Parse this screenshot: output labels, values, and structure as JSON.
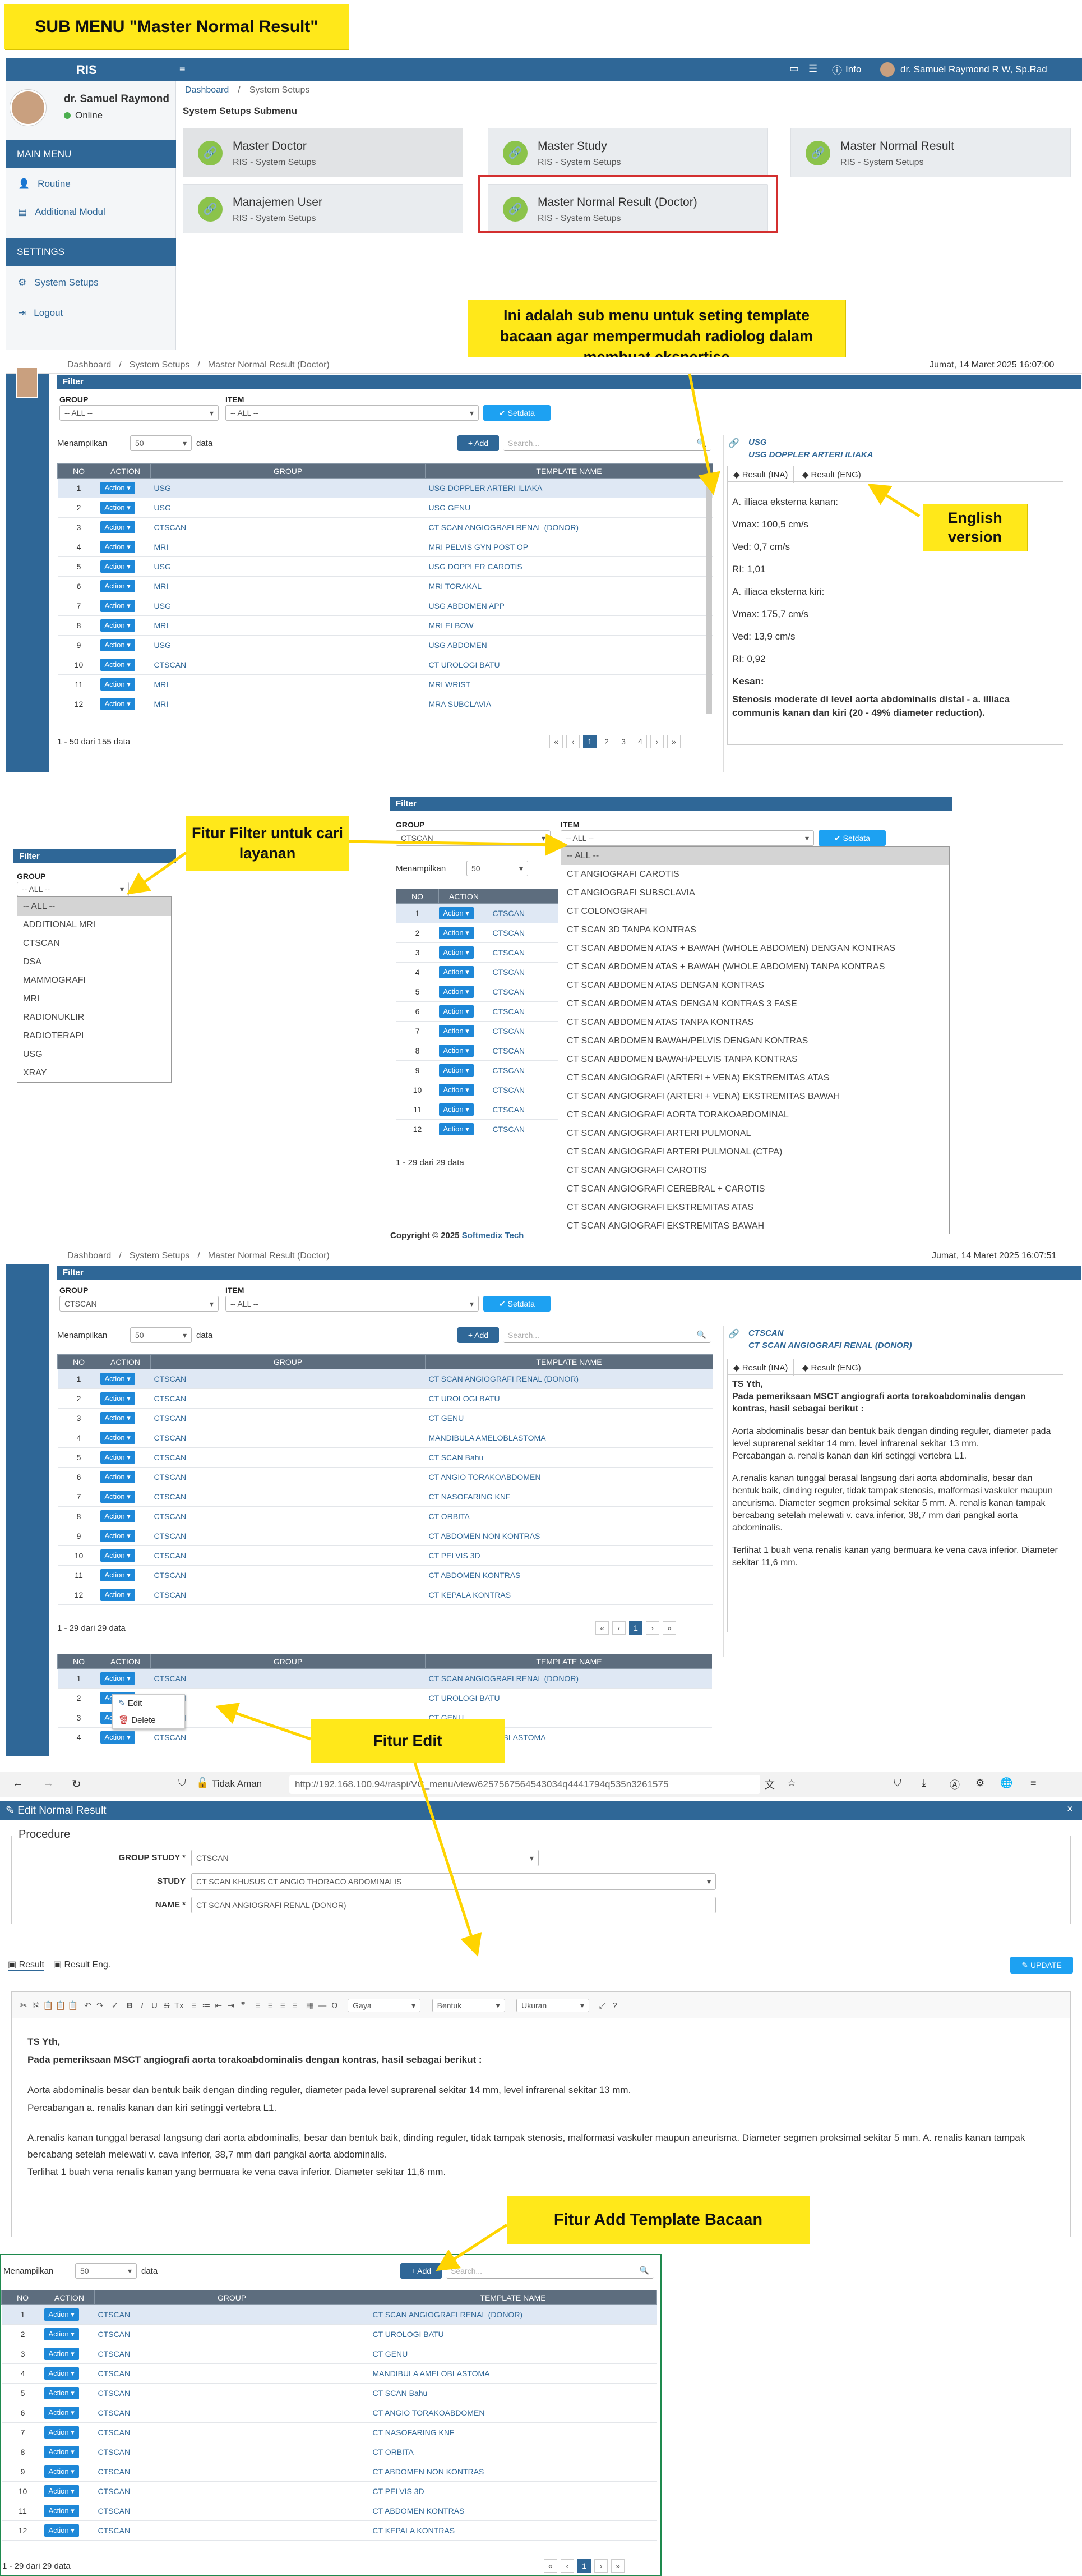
{
  "notes": {
    "title": "SUB MENU \"Master Normal Result\"",
    "info": "Ini adalah sub menu untuk seting template bacaan agar mempermudah radiolog dalam membuat ekspertise",
    "english": "English version",
    "filter": "Fitur Filter untuk cari layanan",
    "edit": "Fitur Edit",
    "add": "Fitur Add Template Bacaan"
  },
  "colors": {
    "primary": "#2f6797",
    "note": "#ffe81a",
    "action": "#1e88d8",
    "tile_icon": "#8bc34a",
    "highlight_box": "#d32f2f"
  },
  "app": {
    "brand": "RIS",
    "user": "dr. Samuel Raymond",
    "status": "Online",
    "topbar_user": "dr. Samuel Raymond R W, Sp.Rad",
    "topbar_info": "Info",
    "main_menu": "MAIN MENU",
    "settings_menu": "SETTINGS",
    "menu": [
      "Routine",
      "Additional Modul"
    ],
    "settings": [
      "System Setups",
      "Logout"
    ],
    "crumb": [
      "Dashboard",
      "System Setups"
    ],
    "submenu_title": "System Setups Submenu",
    "tiles": [
      {
        "title": "Master Doctor",
        "sub": "RIS - System Setups"
      },
      {
        "title": "Master Study",
        "sub": "RIS - System Setups"
      },
      {
        "title": "Master Normal Result",
        "sub": "RIS - System Setups"
      },
      {
        "title": "Manajemen User",
        "sub": "RIS - System Setups"
      },
      {
        "title": "Master Normal Result (Doctor)",
        "sub": "RIS - System Setups"
      }
    ]
  },
  "grid1": {
    "crumb": [
      "Dashboard",
      "System Setups",
      "Master Normal Result (Doctor)"
    ],
    "date": "Jumat, 14 Maret 2025 16:07:00",
    "filter": "Filter",
    "group_label": "GROUP",
    "item_label": "ITEM",
    "all": "-- ALL --",
    "setdata": "Setdata",
    "show_prefix": "Menampilkan",
    "show_n": "50",
    "show_suffix": "data",
    "add": "+ Add",
    "search": "Search...",
    "headers": [
      "NO",
      "ACTION",
      "GROUP",
      "TEMPLATE NAME"
    ],
    "action": "Action",
    "rows": [
      [
        "1",
        "USG",
        "USG DOPPLER ARTERI ILIAKA"
      ],
      [
        "2",
        "USG",
        "USG GENU"
      ],
      [
        "3",
        "CTSCAN",
        "CT SCAN ANGIOGRAFI RENAL (DONOR)"
      ],
      [
        "4",
        "MRI",
        "MRI PELVIS GYN POST OP"
      ],
      [
        "5",
        "USG",
        "USG DOPPLER CAROTIS"
      ],
      [
        "6",
        "MRI",
        "MRI TORAKAL"
      ],
      [
        "7",
        "USG",
        "USG ABDOMEN APP"
      ],
      [
        "8",
        "MRI",
        "MRI ELBOW"
      ],
      [
        "9",
        "USG",
        "USG ABDOMEN"
      ],
      [
        "10",
        "CTSCAN",
        "CT UROLOGI BATU"
      ],
      [
        "11",
        "MRI",
        "MRI WRIST"
      ],
      [
        "12",
        "MRI",
        "MRA SUBCLAVIA"
      ]
    ],
    "count": "1 - 50 dari 155 data",
    "pages": [
      "«",
      "‹",
      "1",
      "2",
      "3",
      "4",
      "›",
      "»"
    ],
    "panel_group": "USG",
    "panel_name": "USG DOPPLER ARTERI ILIAKA",
    "tab_ina": "Result (INA)",
    "tab_eng": "Result (ENG)",
    "result_lines": [
      "A. illiaca eksterna kanan:",
      "Vmax: 100,5 cm/s",
      "Ved: 0,7 cm/s",
      "RI: 1,01",
      "A. illiaca eksterna kiri:",
      "Vmax: 175,7 cm/s",
      "Ved: 13,9 cm/s",
      "RI: 0,92"
    ],
    "kesan_label": "Kesan:",
    "kesan": "Stenosis moderate di level aorta abdominalis distal - a. illiaca communis kanan dan kiri (20 - 49% diameter reduction)."
  },
  "filterdemo": {
    "filter": "Filter",
    "group_label": "GROUP",
    "all": "-- ALL --",
    "groups": [
      "-- ALL --",
      "ADDITIONAL MRI",
      "CTSCAN",
      "DSA",
      "MAMMOGRAFI",
      "MRI",
      "RADIONUKLIR",
      "RADIOTERAPI",
      "USG",
      "XRAY"
    ],
    "selected_group": "CTSCAN",
    "item_label": "ITEM",
    "setdata": "Setdata",
    "show_prefix": "Menampilkan",
    "show_n": "50",
    "items": [
      "-- ALL --",
      "CT ANGIOGRAFI CAROTIS",
      "CT ANGIOGRAFI SUBSCLAVIA",
      "CT COLONOGRAFI",
      "CT SCAN 3D TANPA KONTRAS",
      "CT SCAN ABDOMEN ATAS + BAWAH (WHOLE ABDOMEN) DENGAN KONTRAS",
      "CT SCAN ABDOMEN ATAS + BAWAH (WHOLE ABDOMEN) TANPA KONTRAS",
      "CT SCAN ABDOMEN ATAS DENGAN KONTRAS",
      "CT SCAN ABDOMEN ATAS DENGAN KONTRAS 3 FASE",
      "CT SCAN ABDOMEN ATAS TANPA KONTRAS",
      "CT SCAN ABDOMEN BAWAH/PELVIS DENGAN KONTRAS",
      "CT SCAN ABDOMEN BAWAH/PELVIS TANPA KONTRAS",
      "CT SCAN ANGIOGRAFI (ARTERI + VENA) EKSTREMITAS ATAS",
      "CT SCAN ANGIOGRAFI (ARTERI + VENA) EKSTREMITAS BAWAH",
      "CT SCAN ANGIOGRAFI AORTA TORAKOABDOMINAL",
      "CT SCAN ANGIOGRAFI ARTERI PULMONAL",
      "CT SCAN ANGIOGRAFI ARTERI PULMONAL (CTPA)",
      "CT SCAN ANGIOGRAFI CAROTIS",
      "CT SCAN ANGIOGRAFI CEREBRAL + CAROTIS",
      "CT SCAN ANGIOGRAFI EKSTREMITAS ATAS",
      "CT SCAN ANGIOGRAFI EKSTREMITAS BAWAH"
    ],
    "headers": [
      "NO",
      "ACTION"
    ],
    "group_val": "CTSCAN",
    "rows": [
      "1",
      "2",
      "3",
      "4",
      "5",
      "6",
      "7",
      "8",
      "9",
      "10",
      "11",
      "12"
    ],
    "count": "1 - 29 dari 29 data",
    "copyright_a": "Copyright © 2025 ",
    "copyright_b": "Softmedix Tech"
  },
  "grid2": {
    "crumb": [
      "Dashboard",
      "System Setups",
      "Master Normal Result (Doctor)"
    ],
    "date": "Jumat, 14 Maret 2025 16:07:51",
    "group_val": "CTSCAN",
    "rows": [
      [
        "1",
        "CTSCAN",
        "CT SCAN ANGIOGRAFI RENAL (DONOR)"
      ],
      [
        "2",
        "CTSCAN",
        "CT UROLOGI BATU"
      ],
      [
        "3",
        "CTSCAN",
        "CT GENU"
      ],
      [
        "4",
        "CTSCAN",
        "MANDIBULA AMELOBLASTOMA"
      ],
      [
        "5",
        "CTSCAN",
        "CT SCAN Bahu"
      ],
      [
        "6",
        "CTSCAN",
        "CT ANGIO TORAKOABDOMEN"
      ],
      [
        "7",
        "CTSCAN",
        "CT NASOFARING KNF"
      ],
      [
        "8",
        "CTSCAN",
        "CT ORBITA"
      ],
      [
        "9",
        "CTSCAN",
        "CT ABDOMEN NON KONTRAS"
      ],
      [
        "10",
        "CTSCAN",
        "CT PELVIS 3D"
      ],
      [
        "11",
        "CTSCAN",
        "CT ABDOMEN KONTRAS"
      ],
      [
        "12",
        "CTSCAN",
        "CT KEPALA KONTRAS"
      ]
    ],
    "count": "1 - 29 dari 29 data",
    "panel_group": "CTSCAN",
    "panel_name": "CT SCAN ANGIOGRAFI RENAL (DONOR)",
    "p_greet": "TS Yth,",
    "p_intro": "Pada pemeriksaan MSCT angiografi aorta torakoabdominalis dengan kontras, hasil sebagai berikut :",
    "p_1": "Aorta abdominalis besar dan bentuk baik dengan dinding reguler, diameter pada level suprarenal sekitar 14 mm, level infrarenal sekitar 13 mm.",
    "p_2": "Percabangan a. renalis kanan dan kiri setinggi vertebra L1.",
    "p_3": "A.renalis kanan tunggal berasal langsung dari aorta abdominalis, besar dan bentuk baik, dinding reguler, tidak tampak stenosis, malformasi vaskuler maupun aneurisma. Diameter segmen proksimal sekitar 5 mm. A. renalis kanan tampak bercabang setelah melewati v. cava inferior, 38,7 mm dari pangkal aorta abdominalis.",
    "p_4": "Terlihat 1 buah vena renalis kanan yang bermuara ke vena cava inferior. Diameter sekitar 11,6 mm."
  },
  "editdemo": {
    "menu": [
      "Edit",
      "Delete"
    ],
    "rows": [
      [
        "1",
        "CTSCAN",
        "CT SCAN ANGIOGRAFI RENAL (DONOR)"
      ],
      [
        "2",
        "CTSCAN",
        "CT UROLOGI BATU"
      ],
      [
        "3",
        "CTSCAN",
        "CT GENU"
      ],
      [
        "4",
        "CTSCAN",
        "MANDIBULA AMELOBLASTOMA"
      ]
    ]
  },
  "editform": {
    "not_secure": "Tidak Aman",
    "url": "http://192.168.100.94/raspi/VC_menu/view/6257567564543034q4441794q535n3261575",
    "title": "Edit Normal Result",
    "procedure": "Procedure",
    "group_label": "GROUP STUDY *",
    "group_val": "CTSCAN",
    "study_label": "STUDY",
    "study_val": "CT SCAN KHUSUS CT ANGIO THORACO ABDOMINALIS",
    "name_label": "NAME *",
    "name_val": "CT SCAN ANGIOGRAFI RENAL (DONOR)",
    "tab_result": "Result",
    "tab_eng": "Result Eng.",
    "update": "UPDATE",
    "style_sel": "Gaya",
    "format_sel": "Bentuk",
    "size_sel": "Ukuran"
  },
  "adddemo": {
    "count": "1 - 29 dari 29 data"
  }
}
